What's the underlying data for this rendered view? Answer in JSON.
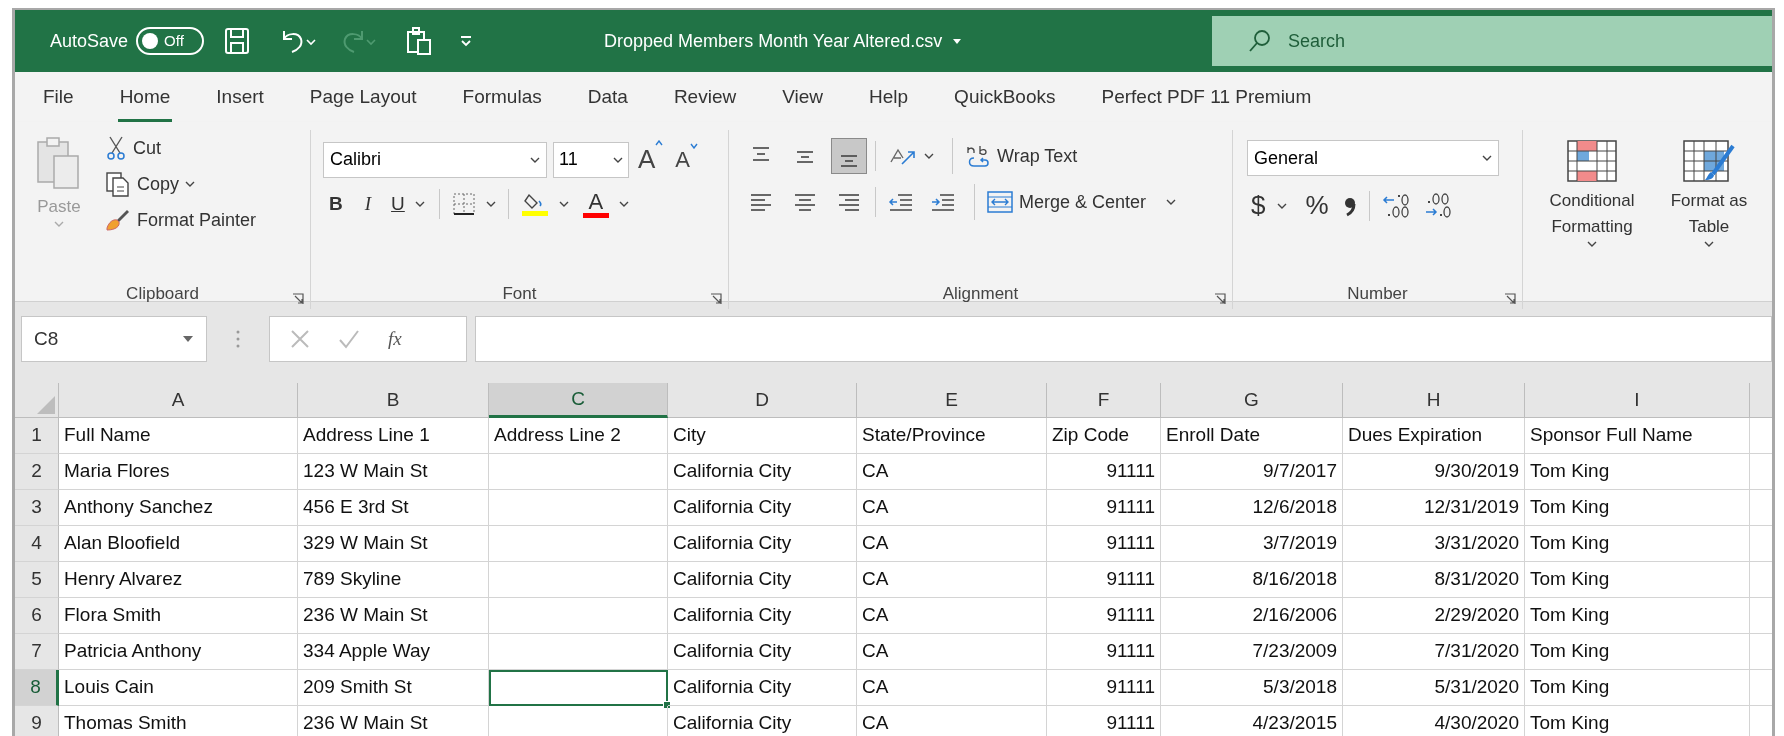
{
  "title_bar": {
    "autosave_label": "AutoSave",
    "autosave_toggle": {
      "label": "Off",
      "on": false
    },
    "quick_access": [
      {
        "kind": "save",
        "disabled": false
      },
      {
        "kind": "undo",
        "disabled": false
      },
      {
        "kind": "redo",
        "disabled": true
      },
      {
        "kind": "clipboard",
        "disabled": false
      },
      {
        "kind": "customize",
        "disabled": false
      }
    ],
    "document_title": "Dropped Members Month Year Altered.csv",
    "search": {
      "placeholder": "Search"
    }
  },
  "tabs": [
    {
      "label": "File",
      "selected": false
    },
    {
      "label": "Home",
      "selected": true
    },
    {
      "label": "Insert",
      "selected": false
    },
    {
      "label": "Page Layout",
      "selected": false
    },
    {
      "label": "Formulas",
      "selected": false
    },
    {
      "label": "Data",
      "selected": false
    },
    {
      "label": "Review",
      "selected": false
    },
    {
      "label": "View",
      "selected": false
    },
    {
      "label": "Help",
      "selected": false
    },
    {
      "label": "QuickBooks",
      "selected": false
    },
    {
      "label": "Perfect PDF 11 Premium",
      "selected": false
    }
  ],
  "ribbon": {
    "clipboard": {
      "label": "Clipboard",
      "paste": {
        "label": "Paste",
        "disabled": true
      },
      "cut": "Cut",
      "copy": "Copy",
      "format_painter": "Format Painter"
    },
    "font": {
      "label": "Font",
      "font_name": "Calibri",
      "font_size": "11",
      "grow_glyph": "A",
      "shrink_glyph": "A",
      "bold": "B",
      "italic": "I",
      "underline": "U",
      "font_color_glyph": "A"
    },
    "alignment": {
      "label": "Alignment",
      "vertical": [
        {
          "kind": "top",
          "selected": false
        },
        {
          "kind": "middle",
          "selected": false
        },
        {
          "kind": "bottom",
          "selected": true
        }
      ],
      "horizontal": [
        {
          "kind": "left",
          "selected": false
        },
        {
          "kind": "center",
          "selected": false
        },
        {
          "kind": "right",
          "selected": false
        }
      ],
      "wrap_text": "Wrap Text",
      "merge_center": "Merge & Center"
    },
    "number": {
      "label": "Number",
      "format": "General",
      "currency": "$",
      "percent": "%"
    },
    "styles": {
      "conditional_formatting": "Conditional Formatting",
      "format_as_table": "Format as Table"
    }
  },
  "formula_bar": {
    "name_box": "C8",
    "function_glyph": "fx"
  },
  "sheet": {
    "columns": [
      {
        "letter": "A",
        "selected": false,
        "right_aligned": false
      },
      {
        "letter": "B",
        "selected": false,
        "right_aligned": false
      },
      {
        "letter": "C",
        "selected": true,
        "right_aligned": false
      },
      {
        "letter": "D",
        "selected": false,
        "right_aligned": false
      },
      {
        "letter": "E",
        "selected": false,
        "right_aligned": false
      },
      {
        "letter": "F",
        "selected": false,
        "right_aligned": true
      },
      {
        "letter": "G",
        "selected": false,
        "right_aligned": true
      },
      {
        "letter": "H",
        "selected": false,
        "right_aligned": true
      },
      {
        "letter": "I",
        "selected": false,
        "right_aligned": false
      }
    ],
    "rows": [
      {
        "number": "1",
        "kind": "header",
        "selected": false,
        "cells": {
          "A": "Full Name",
          "B": "Address Line 1",
          "C": "Address Line 2",
          "D": "City",
          "E": "State/Province",
          "F": "Zip Code",
          "G": "Enroll Date",
          "H": "Dues Expiration",
          "I": "Sponsor Full Name"
        }
      },
      {
        "number": "2",
        "kind": "data",
        "selected": false,
        "cells": {
          "A": "Maria Flores",
          "B": "123 W Main St",
          "D": "California City",
          "E": "CA",
          "F": "91111",
          "G": "9/7/2017",
          "H": "9/30/2019",
          "I": "Tom King"
        }
      },
      {
        "number": "3",
        "kind": "data",
        "selected": false,
        "cells": {
          "A": "Anthony Sanchez",
          "B": "456 E 3rd St",
          "D": "California City",
          "E": "CA",
          "F": "91111",
          "G": "12/6/2018",
          "H": "12/31/2019",
          "I": "Tom King"
        }
      },
      {
        "number": "4",
        "kind": "data",
        "selected": false,
        "cells": {
          "A": "Alan Bloofield",
          "B": "329 W Main St",
          "D": "California City",
          "E": "CA",
          "F": "91111",
          "G": "3/7/2019",
          "H": "3/31/2020",
          "I": "Tom King"
        }
      },
      {
        "number": "5",
        "kind": "data",
        "selected": false,
        "cells": {
          "A": "Henry Alvarez",
          "B": "789 Skyline",
          "D": "California City",
          "E": "CA",
          "F": "91111",
          "G": "8/16/2018",
          "H": "8/31/2020",
          "I": "Tom King"
        }
      },
      {
        "number": "6",
        "kind": "data",
        "selected": false,
        "cells": {
          "A": "Flora Smith",
          "B": "236 W Main St",
          "D": "California City",
          "E": "CA",
          "F": "91111",
          "G": "2/16/2006",
          "H": "2/29/2020",
          "I": "Tom King"
        }
      },
      {
        "number": "7",
        "kind": "data",
        "selected": false,
        "cells": {
          "A": "Patricia Anthony",
          "B": "334 Apple Way",
          "D": "California City",
          "E": "CA",
          "F": "91111",
          "G": "7/23/2009",
          "H": "7/31/2020",
          "I": "Tom King"
        }
      },
      {
        "number": "8",
        "kind": "data",
        "selected": true,
        "cells": {
          "A": "Louis Cain",
          "B": "209 Smith St",
          "D": "California City",
          "E": "CA",
          "F": "91111",
          "G": "5/3/2018",
          "H": "5/31/2020",
          "I": "Tom King"
        }
      },
      {
        "number": "9",
        "kind": "data",
        "selected": false,
        "cells": {
          "A": "Thomas Smith",
          "B": "236 W Main St",
          "D": "California City",
          "E": "CA",
          "F": "91111",
          "G": "4/23/2015",
          "H": "4/30/2020",
          "I": "Tom King"
        }
      }
    ]
  }
}
